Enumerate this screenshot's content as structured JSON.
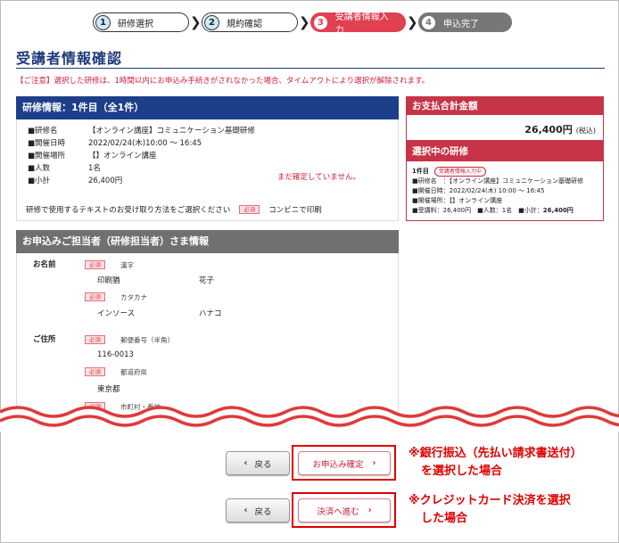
{
  "steps": [
    {
      "num": "1",
      "label": "研修選択"
    },
    {
      "num": "2",
      "label": "規約確認"
    },
    {
      "num": "3",
      "label": "受講者情報入力"
    },
    {
      "num": "4",
      "label": "申込完了"
    }
  ],
  "page_title": "受講者情報確認",
  "notice": "【ご注意】選択した研修は、1時間以内にお申込み手続きがされなかった場合、タイムアウトにより選択が解除されます。",
  "course": {
    "header": "研修情報：1件目（全1件）",
    "rows": [
      {
        "label": "■研修名",
        "value": "【オンライン講座】コミュニケーション基礎研修"
      },
      {
        "label": "■開催日時",
        "value": "2022/02/24(木)10:00 ～ 16:45"
      },
      {
        "label": "■開催場所",
        "value": "【】オンライン講座"
      },
      {
        "label": "■人数",
        "value": "1名"
      },
      {
        "label": "■小計",
        "value": "26,400円"
      }
    ],
    "warning": "まだ確定していません。",
    "text_method_label": "研修で使用するテキストのお受け取り方法をご選択ください",
    "required": "必須",
    "text_method_value": "コンビニで印刷"
  },
  "applicant": {
    "header": "お申込みご担当者（研修担当者）さま情報",
    "name_label": "お名前",
    "required": "必須",
    "kanji_label": "漢字",
    "last_name": "印刷猶",
    "first_name": "花子",
    "kana_label": "カタカナ",
    "last_kana": "インソース",
    "first_kana": "ハナコ",
    "address_label": "ご住所",
    "zip_label": "郵便番号（半角）",
    "zip": "116-0013",
    "pref_label": "都道府県",
    "pref": "東京都",
    "city_label": "市町村・番地"
  },
  "payment": {
    "header": "お支払合計金額",
    "amount": "26,400円",
    "tax": "(税込)"
  },
  "selected": {
    "header": "選択中の研修",
    "item_no": "1件目",
    "badge": "受講者情報入力中",
    "line1": "■研修名　：【オンライン講座】コミュニケーション基礎研修",
    "line2": "■開催日時：2022/02/24(木) 10:00 ～ 16:45",
    "line3": "■開催場所：【】オンライン講座",
    "fee_label": "■受講料：26,400円　■人数：1名　■小計：",
    "subtotal": "26,400円"
  },
  "buttons": {
    "back1": "戻る",
    "apply": "お申込み確定",
    "back2": "戻る",
    "pay": "決済へ進む"
  },
  "annotations": {
    "bank_line1": "※銀行振込（先払い請求書送付）",
    "bank_line2": "を選択した場合",
    "card_line1": "※クレジットカード決済を選択",
    "card_line2": "した場合"
  },
  "colors": {
    "navy": "#1d3f8a",
    "red": "#c83447",
    "highlight": "#e00000"
  }
}
